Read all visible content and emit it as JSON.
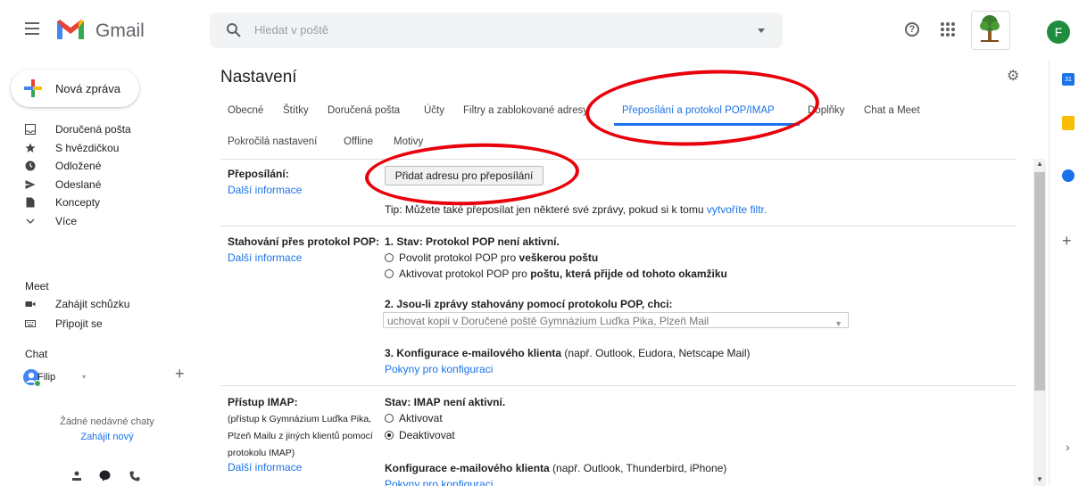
{
  "header": {
    "app_name": "Gmail",
    "search_placeholder": "Hledat v poště",
    "avatar_letter": "F"
  },
  "sidebar": {
    "compose_label": "Nová zpráva",
    "items": [
      {
        "label": "Doručená pošta",
        "icon": "inbox-icon"
      },
      {
        "label": "S hvězdičkou",
        "icon": "star-icon"
      },
      {
        "label": "Odložené",
        "icon": "clock-icon"
      },
      {
        "label": "Odeslané",
        "icon": "send-icon"
      },
      {
        "label": "Koncepty",
        "icon": "draft-icon"
      },
      {
        "label": "Více",
        "icon": "chevron-down-icon"
      }
    ],
    "meet_title": "Meet",
    "meet_items": [
      {
        "label": "Zahájit schůzku",
        "icon": "video-icon"
      },
      {
        "label": "Připojit se",
        "icon": "keyboard-icon"
      }
    ],
    "chat_title": "Chat",
    "chat_user": "Filip",
    "no_chats": "Žádné nedávné chaty",
    "start_new": "Zahájit nový"
  },
  "main": {
    "title": "Nastavení",
    "tabs_row1": [
      "Obecné",
      "Štítky",
      "Doručená pošta",
      "Účty",
      "Filtry a zablokované adresy",
      "Přeposílání a protokol POP/IMAP",
      "Doplňky",
      "Chat a Meet"
    ],
    "tabs_row2": [
      "Pokročilá nastavení",
      "Offline",
      "Motivy"
    ],
    "forwarding": {
      "label": "Přeposílání:",
      "more_info": "Další informace",
      "button": "Přidat adresu pro přeposílání",
      "tip_prefix": "Tip: Můžete také přeposílat jen některé své zprávy, pokud si k tomu",
      "tip_link": "vytvoříte filtr."
    },
    "pop": {
      "label": "Stahování přes protokol POP:",
      "more_info": "Další informace",
      "status": "1. Stav: Protokol POP není aktivní.",
      "opt1_prefix": "Povolit protokol POP pro",
      "opt1_bold": "veškerou poštu",
      "opt2_prefix": "Aktivovat protokol POP pro",
      "opt2_bold": "poštu, která přijde od tohoto okamžiku",
      "q2": "2. Jsou-li zprávy stahovány pomocí protokolu POP, chci:",
      "select_value": "uchovat kopii v Doručené poště Gymnázium Luďka Pika, Plzeň Mail",
      "q3_bold": "3. Konfigurace e-mailového klienta",
      "q3_rest": "(např. Outlook, Eudora, Netscape Mail)",
      "config_link": "Pokyny pro konfiguraci"
    },
    "imap": {
      "label": "Přístup IMAP:",
      "desc_lines": [
        "(přístup k Gymnázium Luďka Pika,",
        "Plzeň Mailu z jiných klientů pomocí",
        "protokolu IMAP)"
      ],
      "more_info": "Další informace",
      "status": "Stav: IMAP není aktivní.",
      "opt_on": "Aktivovat",
      "opt_off": "Deaktivovat",
      "client_bold": "Konfigurace e-mailového klienta",
      "client_rest": "(např. Outlook, Thunderbird, iPhone)",
      "config_link": "Pokyny pro konfiguraci"
    }
  },
  "side_panel": {
    "calendar_day": "31"
  },
  "colors": {
    "accent": "#1a73e8",
    "annotation": "#e8000b",
    "avatar": "#1e8e3e"
  }
}
